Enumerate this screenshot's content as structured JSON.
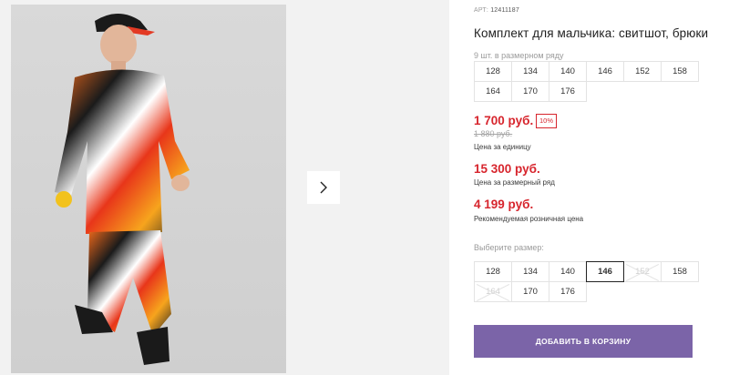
{
  "product": {
    "sku_label": "АРТ:",
    "sku": "12411187",
    "title": "Комплект для мальчика: свитшот, брюки"
  },
  "pack": {
    "label": "9 шт. в размерном ряду",
    "sizes": [
      "128",
      "134",
      "140",
      "146",
      "152",
      "158",
      "164",
      "170",
      "176"
    ]
  },
  "pricing": {
    "unit_price": "1 700 руб.",
    "discount_badge": "10%",
    "old_price": "1 880 руб.",
    "unit_label": "Цена за единицу",
    "pack_price": "15 300 руб.",
    "pack_label": "Цена за размерный ряд",
    "retail_price": "4 199 руб.",
    "retail_label": "Рекомендуемая розничная цена"
  },
  "size_picker": {
    "label": "Выберите размер:",
    "options": [
      {
        "size": "128",
        "state": "available"
      },
      {
        "size": "134",
        "state": "available"
      },
      {
        "size": "140",
        "state": "available"
      },
      {
        "size": "146",
        "state": "selected"
      },
      {
        "size": "152",
        "state": "disabled"
      },
      {
        "size": "158",
        "state": "available"
      },
      {
        "size": "164",
        "state": "disabled"
      },
      {
        "size": "170",
        "state": "available"
      },
      {
        "size": "176",
        "state": "available"
      }
    ]
  },
  "cart_button": {
    "label": "ДОБАВИТЬ В КОРЗИНУ"
  },
  "colors": {
    "price_red": "#d7252d",
    "button_purple": "#7b64a8"
  },
  "icons": {
    "next": "chevron-right-icon"
  }
}
